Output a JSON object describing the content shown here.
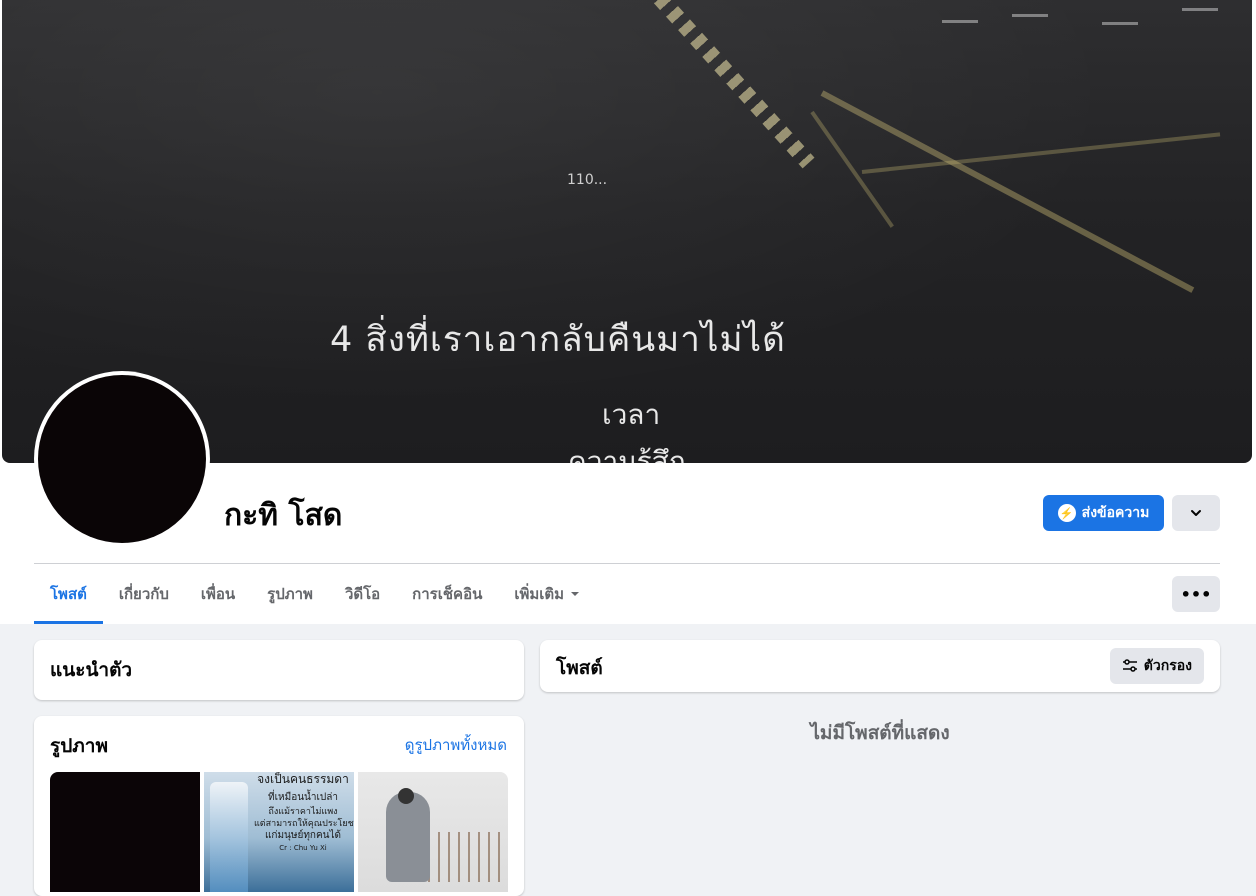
{
  "cover": {
    "small_text": "110...",
    "line1": "4  สิ่งที่เราเอากลับคืนมาไม่ได้",
    "line2": "เวลา",
    "line3": "ความรู้สึก"
  },
  "profile": {
    "name": "กะทิ โสด",
    "send_message_label": "ส่งข้อความ"
  },
  "tabs": [
    {
      "label": "โพสต์",
      "active": true
    },
    {
      "label": "เกี่ยวกับ"
    },
    {
      "label": "เพื่อน"
    },
    {
      "label": "รูปภาพ"
    },
    {
      "label": "วิดีโอ"
    },
    {
      "label": "การเช็คอิน"
    },
    {
      "label": "เพิ่มเติม"
    }
  ],
  "intro": {
    "title": "แนะนำตัว"
  },
  "photos": {
    "title": "รูปภาพ",
    "see_all": "ดูรูปภาพทั้งหมด",
    "photo2_caption": [
      "จงเป็นคนธรรมดา",
      "ที่เหมือนน้ำเปล่า",
      "ถึงแม้ราคาไม่แพง",
      "แต่สามารถให้คุณประโยชน์",
      "แก่มนุษย์ทุกคนได้",
      "Cr : Chu Yu Xi"
    ]
  },
  "posts": {
    "title": "โพสต์",
    "filter_label": "ตัวกรอง",
    "empty_message": "ไม่มีโพสต์ที่แสดง"
  },
  "colors": {
    "accent": "#1b74e4",
    "page_bg": "#f0f2f5"
  }
}
